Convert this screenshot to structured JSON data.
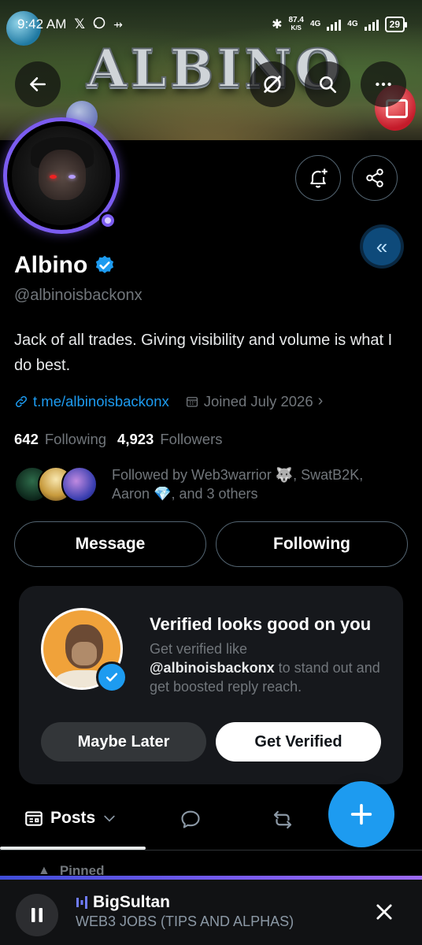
{
  "status_bar": {
    "time": "9:42 AM",
    "speed_value": "87.4",
    "speed_unit": "K/S",
    "net1": "4G",
    "net2": "4G",
    "battery": "29"
  },
  "banner": {
    "title": "ALBINO"
  },
  "profile": {
    "name": "Albino",
    "handle": "@albinoisbackonx",
    "bio": "Jack of all trades. Giving visibility and volume is what I do best.",
    "link": "t.me/albinoisbackonx",
    "joined": "Joined July 2026",
    "following_count": "642",
    "following_label": "Following",
    "followers_count": "4,923",
    "followers_label": "Followers",
    "followed_by": "Followed by Web3warrior 🐺, SwatB2K, Aaron 💎, and 3 others"
  },
  "actions": {
    "message": "Message",
    "following": "Following"
  },
  "verify_card": {
    "title": "Verified looks good on you",
    "text_before": "Get verified like",
    "text_handle": "@albinoisbackonx",
    "text_after": "to stand out and get boosted reply reach.",
    "later": "Maybe Later",
    "get": "Get Verified"
  },
  "tabs": {
    "posts": "Posts"
  },
  "pinned": "Pinned",
  "player": {
    "title": "BigSultan",
    "subtitle": "WEB3 JOBS (TIPS AND ALPHAS)"
  },
  "colors": {
    "accent": "#1d9bf0",
    "ring": "#7b5cf0",
    "background": "#000000"
  }
}
